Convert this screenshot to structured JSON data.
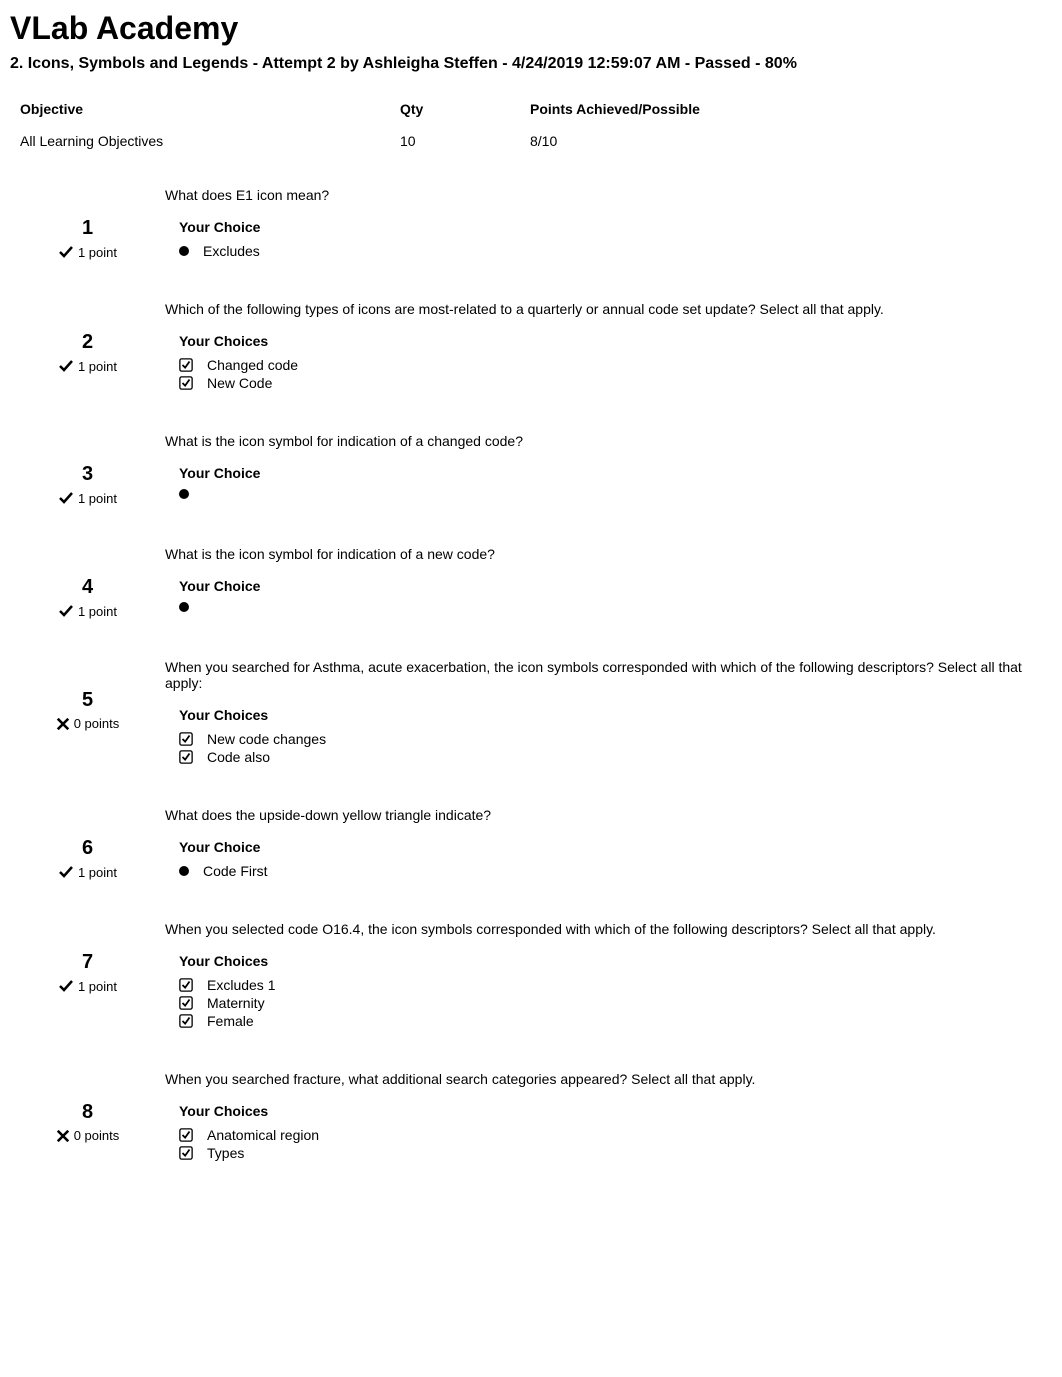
{
  "page_title": "VLab Academy",
  "subtitle": "2. Icons, Symbols and Legends - Attempt 2 by Ashleigha Steffen - 4/24/2019 12:59:07 AM - Passed - 80%",
  "objectives": {
    "header": {
      "objective": "Objective",
      "qty": "Qty",
      "points": "Points Achieved/Possible"
    },
    "rows": [
      {
        "objective": "All Learning Objectives",
        "qty": "10",
        "points": "8/10"
      }
    ]
  },
  "questions": [
    {
      "number": "1",
      "correct": true,
      "points_text": "1 point",
      "text": "What does E1 icon        mean?",
      "choice_label": "Your Choice",
      "choice_type": "radio",
      "choices": [
        "Excludes"
      ]
    },
    {
      "number": "2",
      "correct": true,
      "points_text": "1 point",
      "text": "Which of the following types of icons are most-related to a quarterly or annual code set update? Select all that apply.",
      "choice_label": "Your Choices",
      "choice_type": "checkbox",
      "choices": [
        "Changed code",
        "New Code"
      ]
    },
    {
      "number": "3",
      "correct": true,
      "points_text": "1 point",
      "text": "What is the icon symbol for indication of a changed code?",
      "choice_label": "Your Choice",
      "choice_type": "radio",
      "choices": [
        ""
      ]
    },
    {
      "number": "4",
      "correct": true,
      "points_text": "1 point",
      "text": "What is the icon symbol for indication of a new code?",
      "choice_label": "Your Choice",
      "choice_type": "radio",
      "choices": [
        ""
      ]
    },
    {
      "number": "5",
      "correct": false,
      "points_text": "0 points",
      "text": "When you searched for Asthma, acute exacerbation, the icon symbols corresponded with which of the following descriptors? Select all that apply:",
      "choice_label": "Your Choices",
      "choice_type": "checkbox",
      "choices": [
        "New code changes",
        "Code also"
      ]
    },
    {
      "number": "6",
      "correct": true,
      "points_text": "1 point",
      "text": "What does the upside-down yellow triangle       indicate?",
      "choice_label": "Your Choice",
      "choice_type": "radio",
      "choices": [
        "Code First"
      ]
    },
    {
      "number": "7",
      "correct": true,
      "points_text": "1 point",
      "text": "When you selected code O16.4, the icon symbols corresponded with which of the following descriptors? Select all that apply.",
      "choice_label": "Your Choices",
      "choice_type": "checkbox",
      "choices": [
        "Excludes 1",
        "Maternity",
        "Female"
      ]
    },
    {
      "number": "8",
      "correct": false,
      "points_text": "0 points",
      "text": "When you searched fracture, what additional search categories appeared? Select all that apply.",
      "choice_label": "Your Choices",
      "choice_type": "checkbox",
      "choices": [
        "Anatomical region",
        "Types"
      ]
    }
  ]
}
